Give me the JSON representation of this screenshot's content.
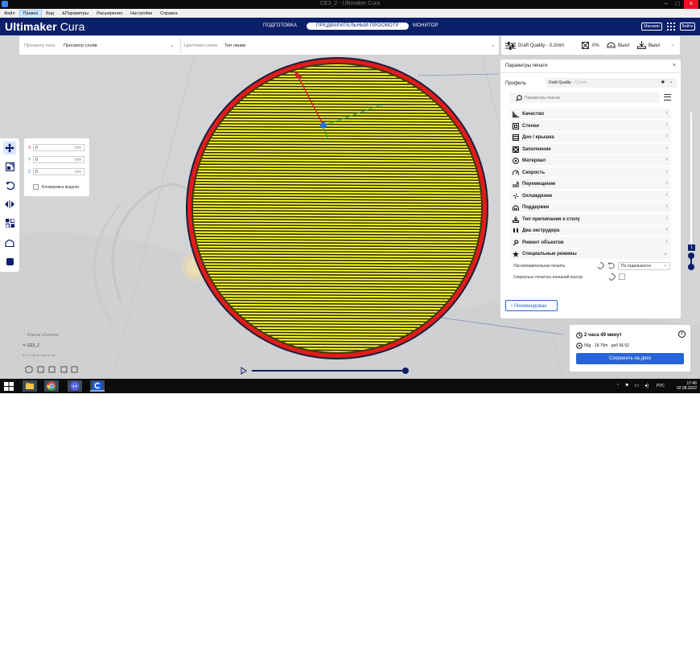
{
  "window": {
    "title": "CE3_2 - Ultimaker Cura"
  },
  "menubar": {
    "items": [
      "Файл",
      "Правка",
      "Вид",
      "&Параметры",
      "Расширения",
      "Настройки",
      "Справка"
    ]
  },
  "header": {
    "brand_bold": "Ultimaker",
    "brand_light": "Cura",
    "tabs": [
      "ПОДГОТОВКА",
      "ПРЕДВАРИТЕЛЬНЫЙ ПРОСМОТР",
      "МОНИТОР"
    ],
    "active_tab": "ПРЕДВАРИТЕЛЬНЫЙ ПРОСМОТР",
    "marketplace": "Магазин",
    "login": "Войти"
  },
  "viewbar": {
    "view_type_label": "Просмотр типа",
    "view_type_value": "Просмотр слоёв",
    "color_scheme_label": "Цветовая схема",
    "color_scheme_value": "Тип линии"
  },
  "printbar": {
    "profile": "Draft Quality - 0.2mm",
    "infill": "0%",
    "support": "Выкл",
    "adhesion": "Выкл"
  },
  "move_panel": {
    "x": "0",
    "y": "0",
    "z": "0",
    "unit": "mm",
    "lock_label": "Блокировка модели"
  },
  "settings": {
    "title": "Параметры печати",
    "profile_label": "Профиль",
    "profile_value": "Draft Quality",
    "profile_suffix": "- 0.2mm",
    "search_placeholder": "Параметры поиска",
    "categories": [
      {
        "name": "Качество",
        "icon": "quality-icon"
      },
      {
        "name": "Стенки",
        "icon": "walls-icon"
      },
      {
        "name": "Дно / крышка",
        "icon": "top-bottom-icon"
      },
      {
        "name": "Заполнение",
        "icon": "infill-icon"
      },
      {
        "name": "Материал",
        "icon": "material-icon"
      },
      {
        "name": "Скорость",
        "icon": "speed-icon"
      },
      {
        "name": "Перемещение",
        "icon": "travel-icon"
      },
      {
        "name": "Охлаждение",
        "icon": "cooling-icon"
      },
      {
        "name": "Поддержки",
        "icon": "support-icon"
      },
      {
        "name": "Тип прилипания к столу",
        "icon": "adhesion-icon"
      },
      {
        "name": "Два экструдера",
        "icon": "dual-extruder-icon"
      },
      {
        "name": "Ремонт объектов",
        "icon": "mesh-fix-icon"
      },
      {
        "name": "Специальные режимы",
        "icon": "special-modes-icon"
      }
    ],
    "print_sequence_label": "Последовательная печать",
    "print_sequence_value": "По отдельности",
    "spiralize_label": "Спирально печатать внешний контур",
    "recommended_button": "Рекомендован"
  },
  "estimate": {
    "time": "2 часа 49 минут",
    "material": "56g · 18.76m · руб 56.52",
    "save_button": "Сохранить на диск"
  },
  "object_list": {
    "header": "Список объектов",
    "object_name": "CE3_2",
    "dimensions": "97.1 x 96.8 x 150.0 мм"
  },
  "layer_slider": {
    "current_layer": "1"
  },
  "taskbar": {
    "language": "РУС",
    "time": "17:46",
    "date": "02.08.2022"
  },
  "colors": {
    "header_bg": "#0b1f6a",
    "accent": "#2665d8",
    "model_fill": "#ffff33",
    "model_wall": "#e21b1b"
  }
}
